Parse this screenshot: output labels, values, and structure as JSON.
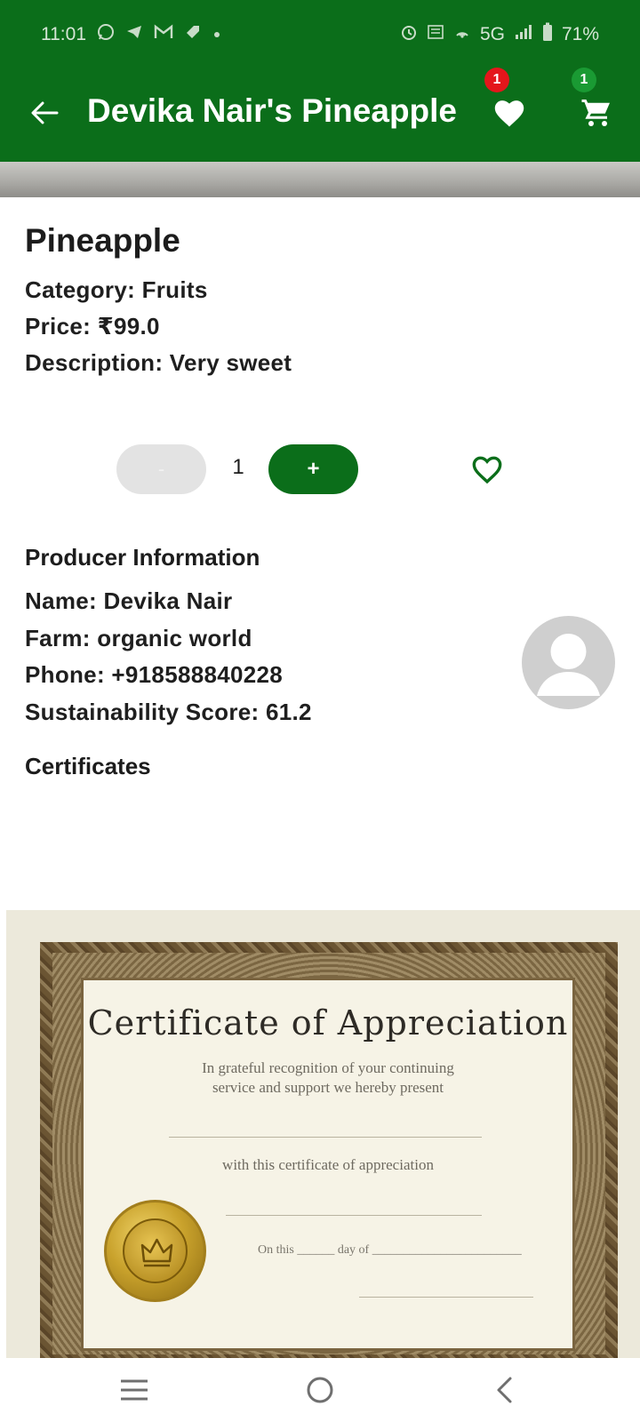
{
  "status_bar": {
    "time": "11:01",
    "network": "5G",
    "battery": "71%",
    "left_icons": [
      "whatsapp-icon",
      "telegram-icon",
      "gmail-icon",
      "tag-icon",
      "dot-icon"
    ],
    "right_icons": [
      "alarm-icon",
      "volte-icon",
      "hotspot-icon",
      "signal-icon",
      "battery-icon"
    ]
  },
  "app_bar": {
    "title": "Devika Nair's Pineapple",
    "wishlist_count": "1",
    "cart_count": "1",
    "background_color": "#0b6e1a"
  },
  "product": {
    "name": "Pineapple",
    "category": "Category: Fruits",
    "price": "Price: ₹99.0",
    "description": "Description: Very sweet"
  },
  "quantity": {
    "minus_label": "-",
    "value": "1",
    "plus_label": "+"
  },
  "producer": {
    "section_title": "Producer Information",
    "name": "Name: Devika Nair",
    "farm": "Farm: organic world",
    "phone": "Phone: +918588840228",
    "sustainability": "Sustainability Score: 61.2",
    "certificates_title": "Certificates"
  },
  "certificate": {
    "heading": "Certificate of Appreciation",
    "subline_1": "In grateful recognition of your continuing",
    "subline_2": "service and support we hereby present",
    "with_text": "with this certificate of appreciation",
    "on_this": "On this ______ day of ________________________"
  },
  "nav_bar": {
    "icons": [
      "recents-icon",
      "home-icon",
      "back-nav-icon"
    ]
  }
}
